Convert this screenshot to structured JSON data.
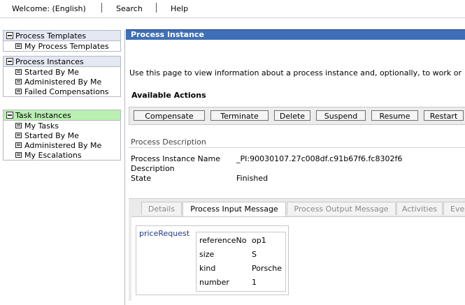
{
  "topnav": {
    "welcome": "Welcome: (English)",
    "search": "Search",
    "help": "Help"
  },
  "nav": {
    "process_templates": {
      "title": "Process Templates",
      "items": [
        "My Process Templates"
      ]
    },
    "process_instances": {
      "title": "Process Instances",
      "items": [
        "Started By Me",
        "Administered By Me",
        "Failed Compensations"
      ]
    },
    "task_instances": {
      "title": "Task Instances",
      "items": [
        "My Tasks",
        "Started By Me",
        "Administered By Me",
        "My Escalations"
      ]
    }
  },
  "main": {
    "title": "Process Instance",
    "intro": "Use this page to view information about a process instance and, optionally, to work or",
    "available_actions": "Available Actions",
    "actions": [
      "Compensate",
      "Terminate",
      "Delete",
      "Suspend",
      "Resume",
      "Restart"
    ],
    "description_section": "Process Description",
    "fields": {
      "name_label": "Process Instance Name",
      "name_value": "_PI:90030107.27c008df.c91b67f6.fc8302f6",
      "description_label": "Description",
      "state_label": "State",
      "state_value": "Finished"
    },
    "tabs": [
      "Details",
      "Process Input Message",
      "Process Output Message",
      "Activities",
      "Eve"
    ],
    "active_tab": "Process Input Message",
    "message": {
      "name": "priceRequest",
      "rows": [
        {
          "key": "referenceNo",
          "value": "op1"
        },
        {
          "key": "size",
          "value": "S"
        },
        {
          "key": "kind",
          "value": "Porsche"
        },
        {
          "key": "number",
          "value": "1"
        }
      ]
    }
  }
}
